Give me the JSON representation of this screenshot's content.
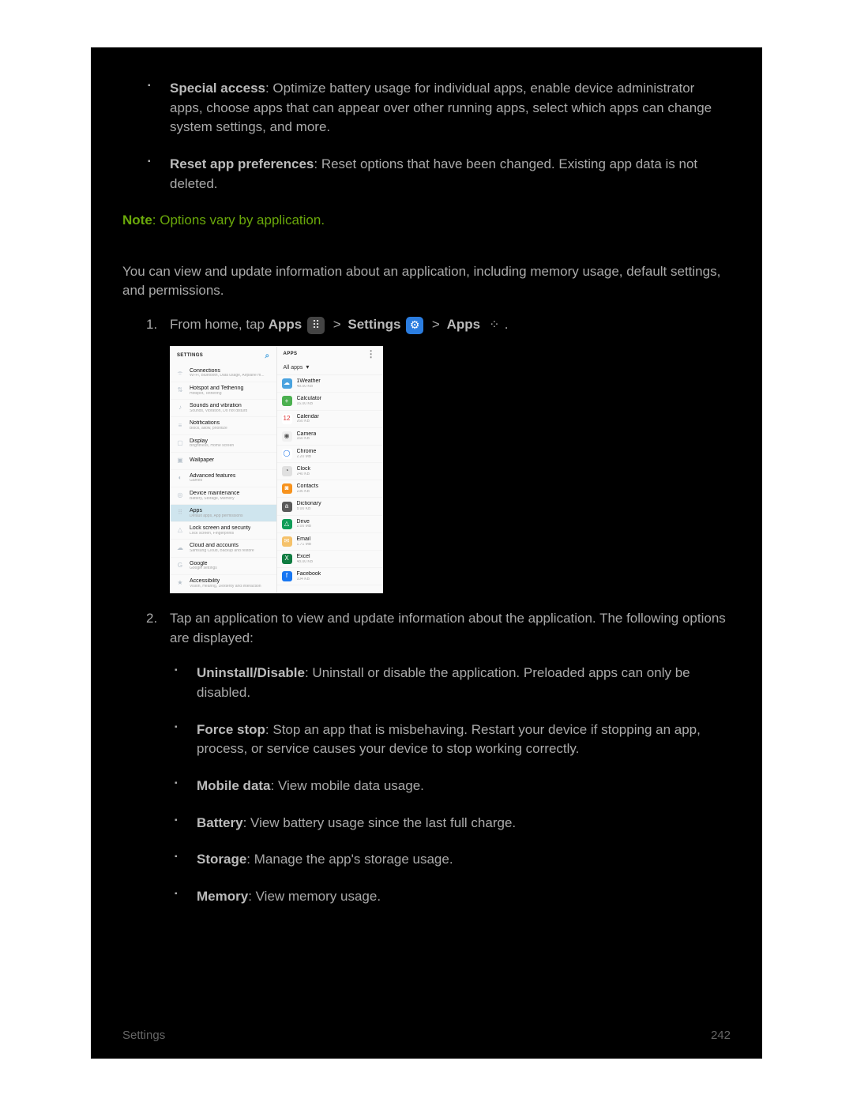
{
  "bullets_top": [
    {
      "label": "Special access",
      "text": ": Optimize battery usage for individual apps, enable device administrator apps, choose apps that can appear over other running apps, select which apps can change system settings, and more."
    },
    {
      "label": "Reset app preferences",
      "text": ": Reset options that have been changed. Existing app data is not deleted."
    }
  ],
  "note": {
    "label": "Note",
    "text": ": Options vary by application."
  },
  "intro": "You can view and update information about an application, including memory usage, default settings, and permissions.",
  "step1": {
    "number": "1.",
    "prefix": "From home, tap ",
    "apps_label": "Apps",
    "gt1": ">",
    "settings_label": "Settings",
    "gt2": ">",
    "apps_label2": "Apps",
    "period": "."
  },
  "shot": {
    "left_header": "SETTINGS",
    "right_header": "APPS",
    "filter": "All apps",
    "left_rows": [
      {
        "icon": "⌯",
        "title": "Connections",
        "sub": "Wi-Fi, Bluetooth, Data usage, Airplane m..."
      },
      {
        "icon": "⇅",
        "title": "Hotspot and Tethering",
        "sub": "Hotspot, Tethering"
      },
      {
        "icon": "♪",
        "title": "Sounds and vibration",
        "sub": "Sounds, Vibration, Do not disturb"
      },
      {
        "icon": "≡",
        "title": "Notifications",
        "sub": "Block, allow, prioritize"
      },
      {
        "icon": "▢",
        "title": "Display",
        "sub": "Brightness, Home screen"
      },
      {
        "icon": "▣",
        "title": "Wallpaper",
        "sub": ""
      },
      {
        "icon": "◐",
        "title": "Advanced features",
        "sub": "Games"
      },
      {
        "icon": "◎",
        "title": "Device maintenance",
        "sub": "Battery, Storage, Memory"
      },
      {
        "icon": "⠿",
        "title": "Apps",
        "sub": "Default apps, App permissions",
        "selected": true
      },
      {
        "icon": "△",
        "title": "Lock screen and security",
        "sub": "Lock screen, Fingerprints"
      },
      {
        "icon": "☁",
        "title": "Cloud and accounts",
        "sub": "Samsung Cloud, Backup and restore"
      },
      {
        "icon": "G",
        "title": "Google",
        "sub": "Google settings"
      },
      {
        "icon": "★",
        "title": "Accessibility",
        "sub": "Vision, Hearing, Dexterity and interaction"
      }
    ],
    "right_rows": [
      {
        "bg": "#4aa3df",
        "icon": "☁",
        "title": "1Weather",
        "sub": "48.00 KB"
      },
      {
        "bg": "#4cb050",
        "icon": "+",
        "title": "Calculator",
        "sub": "16.00 KB"
      },
      {
        "bg": "#ffffff",
        "icon": "12",
        "title": "Calendar",
        "sub": "260 KB",
        "fg": "#d33"
      },
      {
        "bg": "#f0f0f0",
        "icon": "◉",
        "title": "Camera",
        "sub": "160 KB",
        "fg": "#555"
      },
      {
        "bg": "#ffffff",
        "icon": "◯",
        "title": "Chrome",
        "sub": "2.20 MB",
        "fg": "#1a73e8"
      },
      {
        "bg": "#e0e0e0",
        "icon": "◔",
        "title": "Clock",
        "sub": "240 KB",
        "fg": "#555"
      },
      {
        "bg": "#f7931e",
        "icon": "◙",
        "title": "Contacts",
        "sub": "236 KB"
      },
      {
        "bg": "#5a5a5a",
        "icon": "a",
        "title": "Dictionary",
        "sub": "8.00 KB"
      },
      {
        "bg": "#0f9d58",
        "icon": "△",
        "title": "Drive",
        "sub": "2.00 MB"
      },
      {
        "bg": "#f5c26b",
        "icon": "✉",
        "title": "Email",
        "sub": "1.71 MB"
      },
      {
        "bg": "#107c41",
        "icon": "X",
        "title": "Excel",
        "sub": "48.00 KB"
      },
      {
        "bg": "#1877f2",
        "icon": "f",
        "title": "Facebook",
        "sub": "104 KB"
      }
    ]
  },
  "step2": {
    "number": "2.",
    "text": "Tap an application to view and update information about the application. The following options are displayed:"
  },
  "bullets_bottom": [
    {
      "label": "Uninstall/Disable",
      "text": ": Uninstall or disable the application. Preloaded apps can only be disabled."
    },
    {
      "label": "Force stop",
      "text": ": Stop an app that is misbehaving. Restart your device if stopping an app, process, or service causes your device to stop working correctly."
    },
    {
      "label": "Mobile data",
      "text": ": View mobile data usage."
    },
    {
      "label": "Battery",
      "text": ": View battery usage since the last full charge."
    },
    {
      "label": "Storage",
      "text": ": Manage the app's storage usage."
    },
    {
      "label": "Memory",
      "text": ": View memory usage."
    }
  ],
  "footer": {
    "section": "Settings",
    "page": "242"
  }
}
